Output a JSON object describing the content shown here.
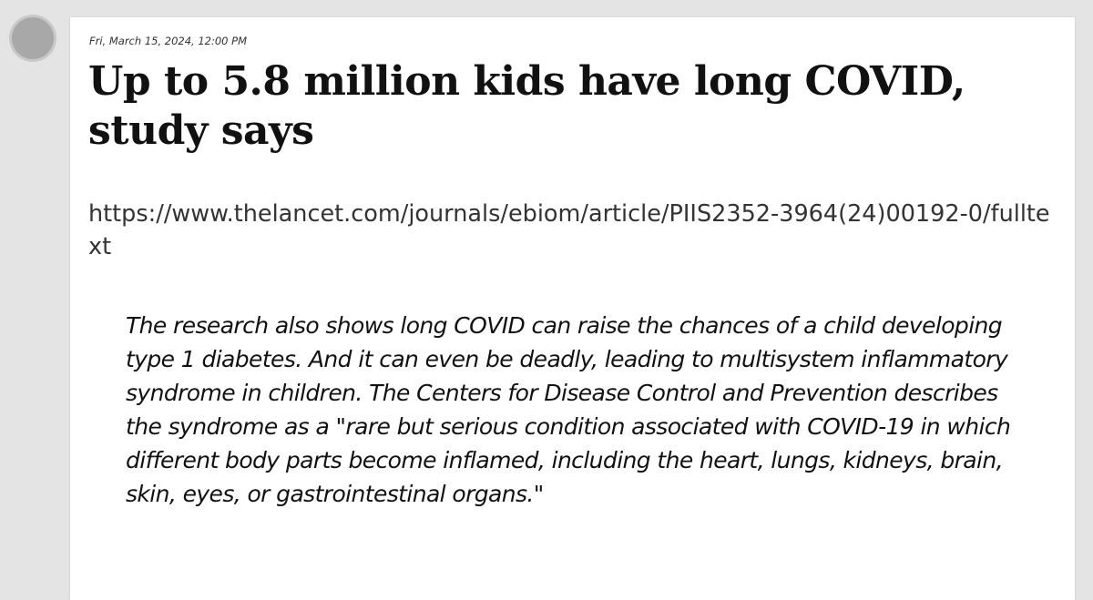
{
  "post": {
    "timestamp": "Fri, March 15, 2024, 12:00 PM",
    "headline": "Up to 5.8 million kids have long COVID, study says",
    "link": "https://www.thelancet.com/journals/ebiom/article/PIIS2352-3964(24)00192-0/fulltext",
    "quote": "The research also shows long COVID can raise the chances of a child developing type 1 diabetes. And it can even be deadly, leading to multisystem inflammatory syndrome in children. The Centers for Disease Control and Prevention describes the syndrome as a \"rare but serious condition associated with COVID-19 in which different body parts become inflamed, including the heart, lungs, kidneys, brain, skin, eyes, or gastrointestinal organs.\""
  },
  "colors": {
    "background": "#e4e4e4",
    "card": "#ffffff",
    "avatar": "#a8a8a8"
  }
}
